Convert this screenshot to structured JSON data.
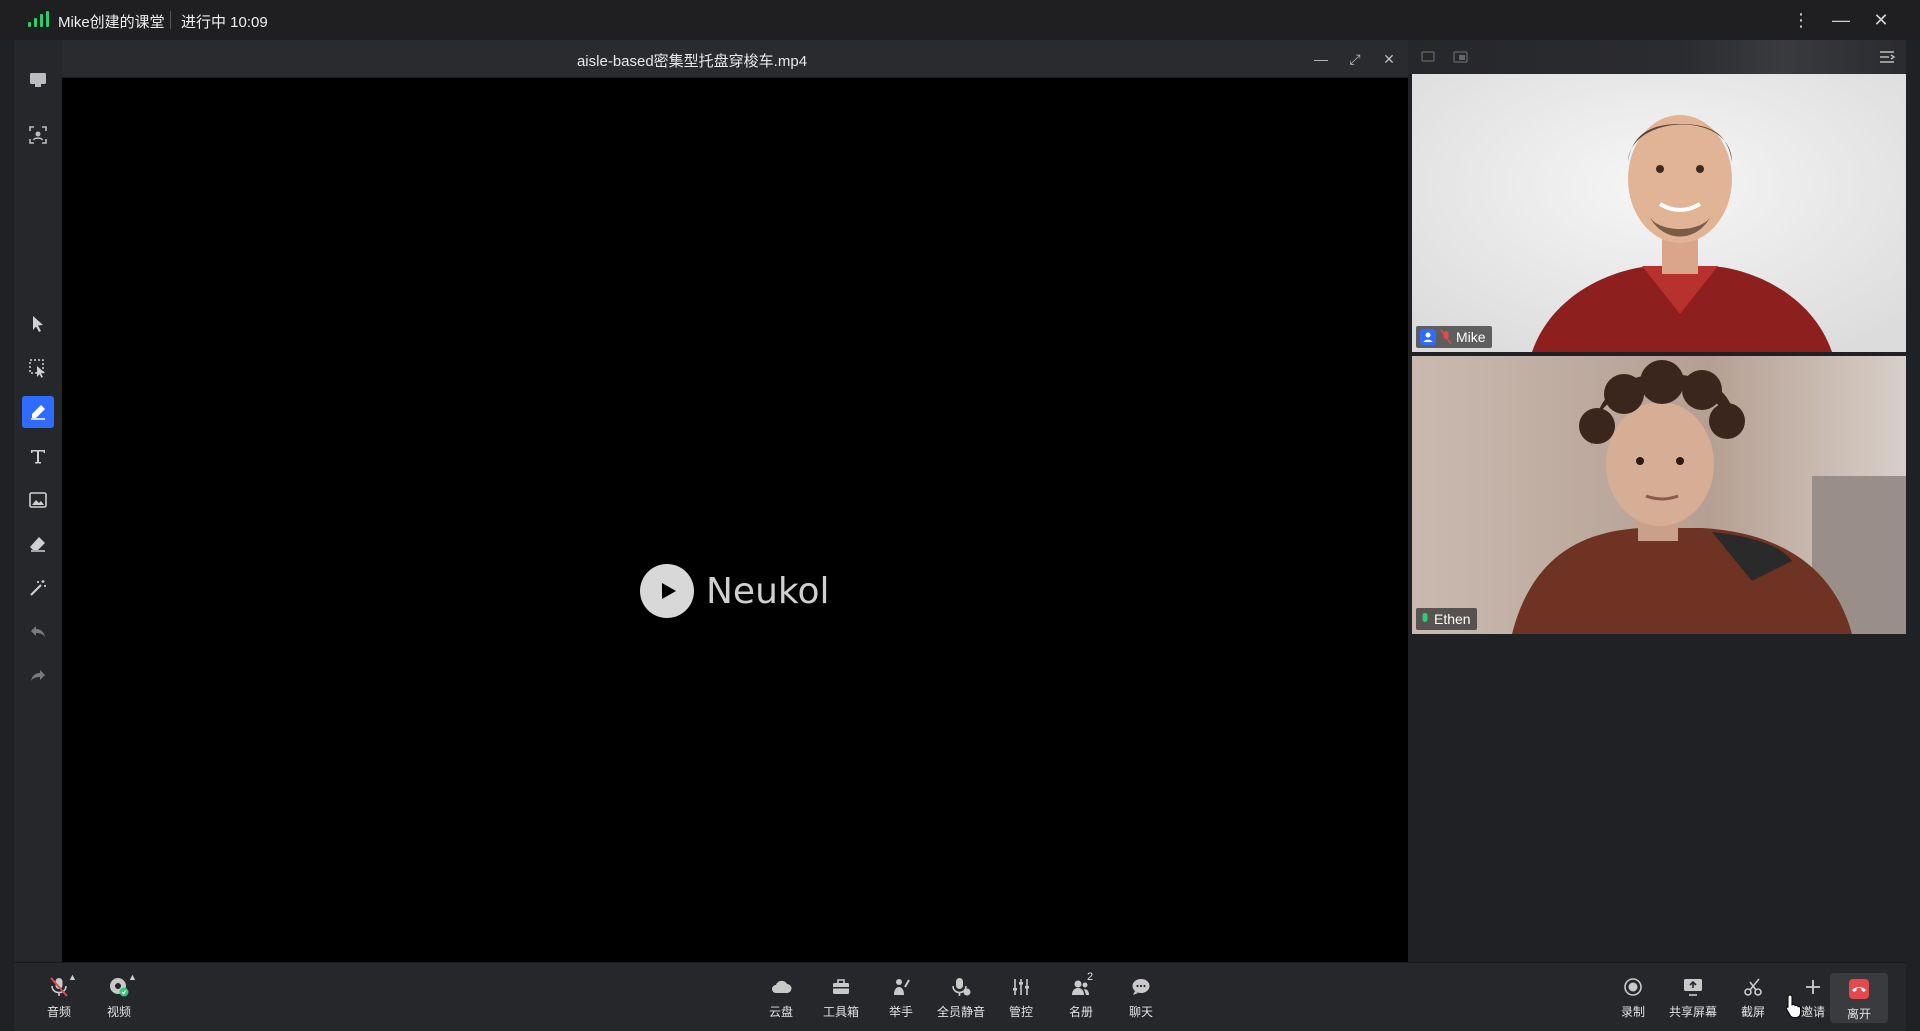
{
  "titlebar": {
    "title": "Mike创建的课堂",
    "status": "进行中 10:09"
  },
  "media": {
    "filename": "aisle-based密集型托盘穿梭车.mp4",
    "brand": "Neukol"
  },
  "participants": [
    {
      "name": "Mike",
      "role": "host"
    },
    {
      "name": "Ethen",
      "role": "student"
    }
  ],
  "bottom_left": [
    {
      "label": "音频"
    },
    {
      "label": "视频"
    }
  ],
  "bottom_center": [
    {
      "label": "云盘"
    },
    {
      "label": "工具箱"
    },
    {
      "label": "举手"
    },
    {
      "label": "全员静音"
    },
    {
      "label": "管控"
    },
    {
      "label": "名册",
      "badge": "2"
    },
    {
      "label": "聊天"
    }
  ],
  "bottom_right": [
    {
      "label": "录制"
    },
    {
      "label": "共享屏幕"
    },
    {
      "label": "截屏"
    },
    {
      "label": "邀请"
    },
    {
      "label": "离开"
    }
  ],
  "colors": {
    "accent": "#2f6bff",
    "leave": "#e5484d",
    "signal": "#2ecc71"
  }
}
